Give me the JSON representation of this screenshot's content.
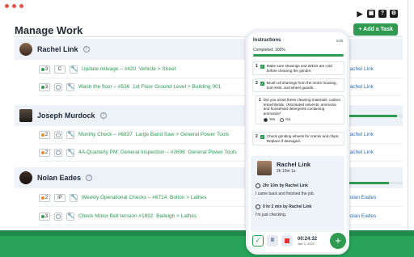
{
  "window": {
    "dot_colors": [
      "#e5534b",
      "#e5534b",
      "#e5534b"
    ]
  },
  "toolbar": {
    "icons": [
      "play-icon",
      "add-icon",
      "help-icon",
      "gear-icon"
    ],
    "help_glyph": "?",
    "gear_glyph": "⚙",
    "add_glyph": "▣"
  },
  "page": {
    "title": "Manage Work",
    "add_task_label": "+ Add a Task"
  },
  "groups": [
    {
      "name": "Rachel Link",
      "tasks": [
        {
          "count": "3",
          "status_color": "#2e9b51",
          "kind": "C",
          "title": "Update mileage – #420",
          "location": "Vehicle > Street",
          "assignee": "Rachel Link"
        },
        {
          "count": "3",
          "status_color": "#2e9b51",
          "kind": "",
          "title": "Wash the floor – #536",
          "location": "1st Floor Ground Level > Building 001",
          "assignee": "Rachel Link"
        }
      ]
    },
    {
      "name": "Joseph Murdock",
      "progress": 0.9,
      "tasks": [
        {
          "count": "2",
          "status_color": "#e98a2b",
          "kind": "",
          "title": "Monthy Check – #6837",
          "location": "Large Band Saw > General Power Tools",
          "assignee": "Rachel Link"
        },
        {
          "count": "2",
          "status_color": "#e98a2b",
          "kind": "",
          "title": "4A-Quarterly PM: General Inspection – #2698",
          "location": "General Power Tools",
          "assignee": "Rachel Link"
        }
      ]
    },
    {
      "name": "Nolan Eades",
      "progress": 0.75,
      "tasks": [
        {
          "count": "2",
          "status_color": "#e98a2b",
          "kind": "IP",
          "title": "Weekly Operational Checks – #6714",
          "location": "Bolton > Lathes",
          "assignee": "Nolan Eades"
        },
        {
          "count": "3",
          "status_color": "#2e9b51",
          "kind": "",
          "title": "Check Motor Belt tension #1892",
          "location": "Baileigh > Lathes",
          "assignee": "Nolan Eades"
        }
      ]
    }
  ],
  "phone": {
    "header": "Instructions",
    "edit_label": "Edit",
    "completed_label": "Completed: 100%",
    "completed_pct": 100,
    "steps": [
      {
        "num": "1",
        "text": "Make sure shavings and debris are cold before cleaning the grinder."
      },
      {
        "num": "2",
        "text": "Brush all shavings from the motor housing, tool rests, and wheel guards."
      },
      {
        "num": "1",
        "text": "Did you avoid these cleaning materials: carbon tetrachloride, chlorinated solvents, ammonia and household detergents containing ammonia?",
        "options": [
          "Yes",
          "No"
        ],
        "selected": "Yes"
      },
      {
        "num": "2",
        "text": "Check grinding wheels for cracks and chips. Replace if damaged."
      }
    ],
    "card": {
      "name": "Rachel Link",
      "elapsed": "2h 10m 1s",
      "logs": [
        {
          "title": "2hr 10m by Rachel Link",
          "note": "I came back and finished the job."
        },
        {
          "title": "0 hr 2 min by Rachel Link",
          "note": "I'm just checking."
        }
      ]
    },
    "timer": {
      "value": "00:24:32",
      "date": "Jan 3, 2022"
    },
    "check_glyph": "✓",
    "pause_glyph": "II",
    "fab_glyph": "+"
  }
}
